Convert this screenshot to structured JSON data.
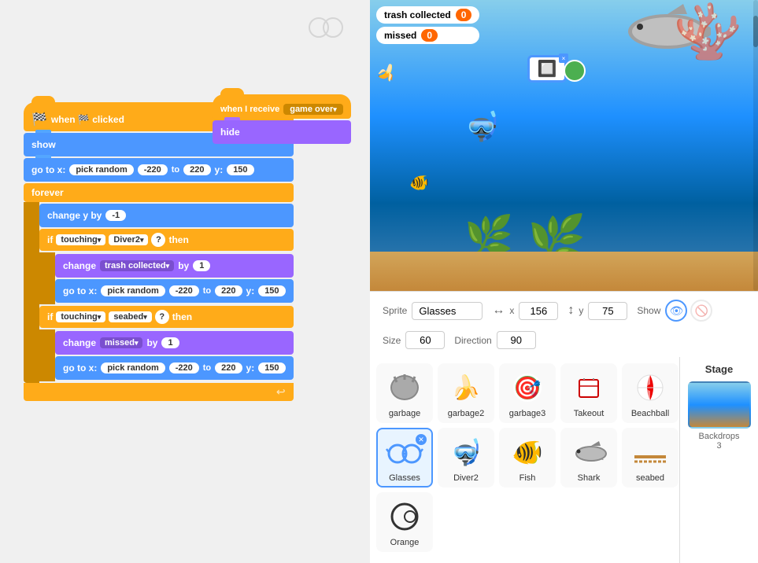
{
  "code_panel": {
    "bg": "#f0f0f0"
  },
  "blocks": {
    "stack1": {
      "hat": "when 🏁 clicked",
      "blocks": [
        "show",
        "go to x:",
        "forever",
        "change y by",
        "if touching Diver2 then",
        "change trash collected by 1",
        "go to x: pick random -220 to 220 y: 150",
        "if touching seabed then",
        "change missed by 1",
        "go to x: pick random -220 to 220 y: 150"
      ]
    },
    "stack2": {
      "hat": "when I receive  game over ▾",
      "blocks": [
        "hide"
      ]
    }
  },
  "game": {
    "hud": {
      "trash_collected_label": "trash collected",
      "trash_collected_value": "0",
      "missed_label": "missed",
      "missed_value": "0"
    }
  },
  "sprite_info": {
    "sprite_label": "Sprite",
    "sprite_name": "Glasses",
    "x_label": "x",
    "x_value": "156",
    "y_label": "y",
    "y_value": "75",
    "show_label": "Show",
    "size_label": "Size",
    "size_value": "60",
    "direction_label": "Direction",
    "direction_value": "90"
  },
  "sprites": [
    {
      "id": "garbage",
      "label": "garbage",
      "emoji": "🦈",
      "selected": false
    },
    {
      "id": "garbage2",
      "label": "garbage2",
      "emoji": "🍌",
      "selected": false
    },
    {
      "id": "garbage3",
      "label": "garbage3",
      "emoji": "🎯",
      "selected": false
    },
    {
      "id": "takeout",
      "label": "Takeout",
      "emoji": "🥡",
      "selected": false
    },
    {
      "id": "beachball",
      "label": "Beachball",
      "emoji": "⚾",
      "selected": false
    },
    {
      "id": "glasses",
      "label": "Glasses",
      "emoji": "👓",
      "selected": true
    },
    {
      "id": "diver2",
      "label": "Diver2",
      "emoji": "🤿",
      "selected": false
    },
    {
      "id": "fish",
      "label": "Fish",
      "emoji": "🐠",
      "selected": false
    },
    {
      "id": "shark",
      "label": "Shark",
      "emoji": "🦈",
      "selected": false
    },
    {
      "id": "seabed",
      "label": "seabed",
      "emoji": "〰️",
      "selected": false
    },
    {
      "id": "orange",
      "label": "Orange",
      "emoji": "🟢",
      "selected": false
    }
  ],
  "stage": {
    "title": "Stage",
    "backdrops_label": "Backdrops",
    "backdrops_count": "3"
  }
}
